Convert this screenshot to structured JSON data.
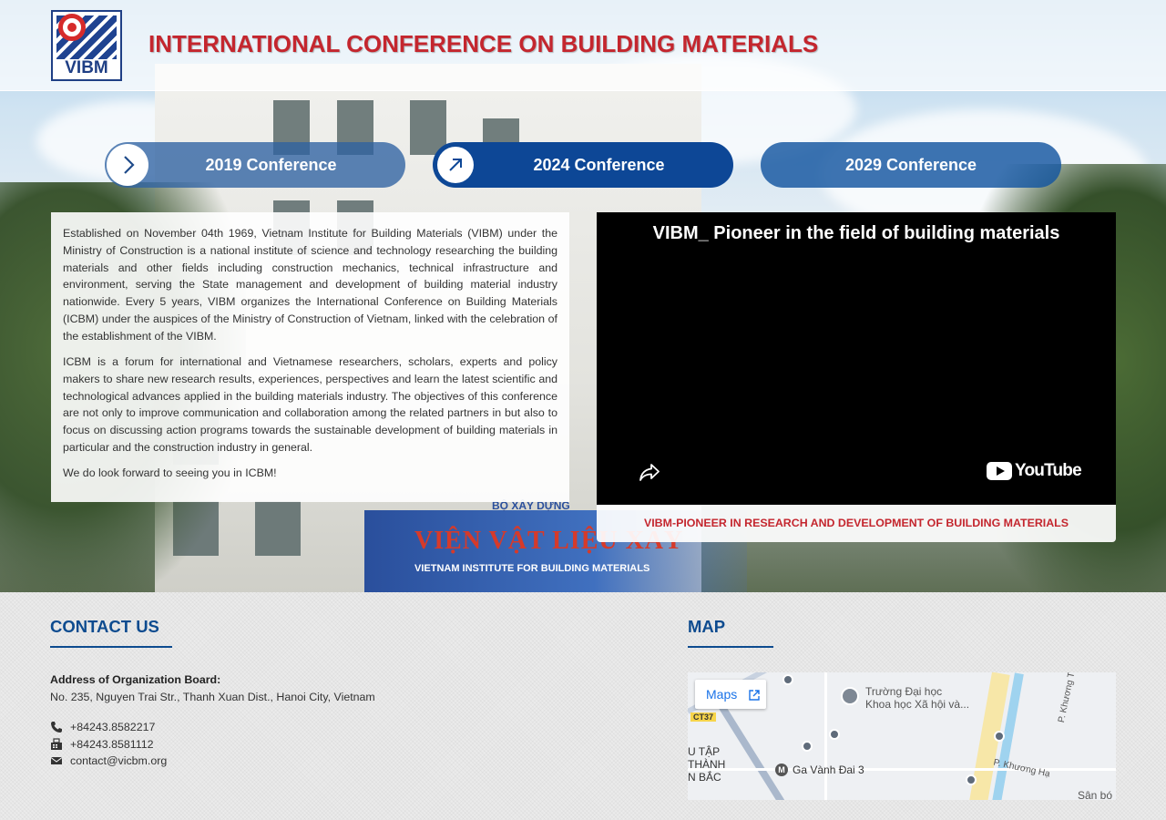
{
  "header": {
    "logo_text": "VIBM",
    "title": "INTERNATIONAL CONFERENCE ON BUILDING MATERIALS"
  },
  "conferences": [
    {
      "label": "2019 Conference",
      "arrow": "chevron-right-icon"
    },
    {
      "label": "2024 Conference",
      "arrow": "arrow-up-right-icon"
    },
    {
      "label": "2029 Conference"
    }
  ],
  "intro": {
    "paragraphs": [
      "Established on November 04th 1969, Vietnam Institute for Building Materials (VIBM) under the Ministry  of Construction is a national institute of science and technology researching the building materials and other fields including construction mechanics, technical infrastructure and environment, serving the State management and development of building material industry nationwide. Every 5 years, VIBM organizes the International Conference on Building Materials (ICBM) under the auspices of the Ministry of Construction of Vietnam, linked with the celebration of the establishment of the VIBM.",
      "ICBM is a forum for international and Vietnamese researchers, scholars, experts and policy makers to share new research results, experiences, perspectives and learn the latest scientific and technological advances applied in the building materials industry. The objectives of this conference are not only to improve communication and collaboration among the related partners in but also to focus on discussing action programs towards the sustainable development of building materials in particular and the construction industry in general.",
      "We do look forward to seeing you in ICBM!"
    ]
  },
  "video": {
    "title": "VIBM_ Pioneer in the field of building materials",
    "brand": "YouTube",
    "caption": "VIBM-PIONEER IN RESEARCH AND DEVELOPMENT OF BUILDING MATERIALS"
  },
  "hero_sign": {
    "top": "BỘ XÂY DỰNG",
    "main": "VIỆN VẬT LIỆU XÂY",
    "sub": "VIETNAM INSTITUTE FOR BUILDING MATERIALS"
  },
  "contact": {
    "heading": "CONTACT US",
    "address_label": "Address of Organization Board:",
    "address": "No. 235, Nguyen Trai Str., Thanh Xuan Dist., Hanoi City, Vietnam",
    "phone": "+84243.8582217",
    "fax": "+84243.8581112",
    "email": "contact@vicbm.org"
  },
  "map": {
    "heading": "MAP",
    "button": "Maps",
    "labels": {
      "university": "Trường Đại học",
      "university2": "Khoa học Xã hội và...",
      "station": "Ga Vành Đai 3",
      "street1": "P. Khương Hạ",
      "street2": "P. Khương T",
      "route": "CT37",
      "area1": "U TẬP",
      "area2": "THÀNH",
      "area3": "N BẮC",
      "corner": "Sân bó"
    }
  },
  "colors": {
    "title_red": "#c4262e",
    "brand_blue": "#0d4796",
    "heading_blue": "#0d4b8f"
  }
}
